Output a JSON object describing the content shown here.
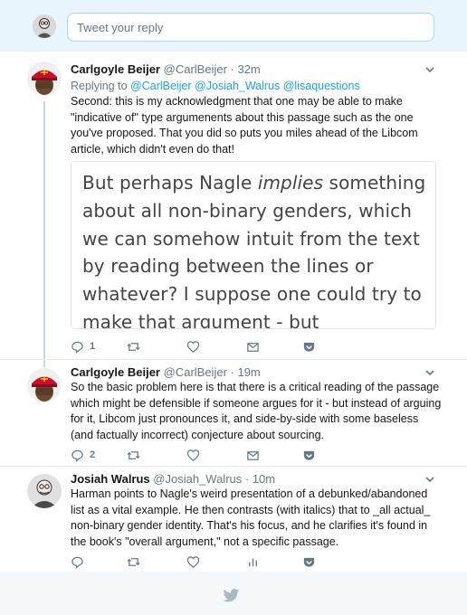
{
  "reply_bar": {
    "placeholder": "Tweet your reply",
    "avatar_alt": "avatar"
  },
  "tweets": [
    {
      "name": "Carlgoyle Beijer",
      "handle": "@CarlBeijer",
      "time": "· 32m",
      "replying_prefix": "Replying to",
      "replying_to": "@CarlBeijer @Josiah_Walrus @lisaquestions",
      "text": "Second: this is my acknowledgment that one may be able to make \"indicative of\" type argumenents about this passage such as the one you've proposed. That you did so puts you miles ahead of the Libcom article, which didn't even do that!",
      "quote_a": "But perhaps Nagle ",
      "quote_em": "implies",
      "quote_b": " something about all non-binary genders, which we can somehow intuit from the text by reading between the lines or whatever? I suppose one could try to make that argument - but remarkably, Harman doesn't even do that! Here are the rest of",
      "reply_count": "1"
    },
    {
      "name": "Carlgoyle Beijer",
      "handle": "@CarlBeijer",
      "time": "· 19m",
      "text": "So the basic problem here is that there is a critical reading of the passage which might be defensible if someone argues for it - but instead of arguing for it, Libcom just pronounces it, and side-by-side with some baseless (and factually incorrect) conjecture about sourcing.",
      "reply_count": "2"
    },
    {
      "name": "Josiah Walrus",
      "handle": "@Josiah_Walrus",
      "time": "· 10m",
      "text": "Harman points to Nagle's weird presentation of a debunked/abandoned list as a vital example. He then contrasts (with italics) that to _all actual_ non-binary gender identity. That's his focus, and he clarifies it's found in the book's \"overall argument,\" not a specific passage.",
      "reply_count": ""
    }
  ],
  "colors": {
    "accent": "#1da1f2",
    "muted": "#657786",
    "border": "#e6ecf0",
    "soviet_red": "#c8102e"
  }
}
